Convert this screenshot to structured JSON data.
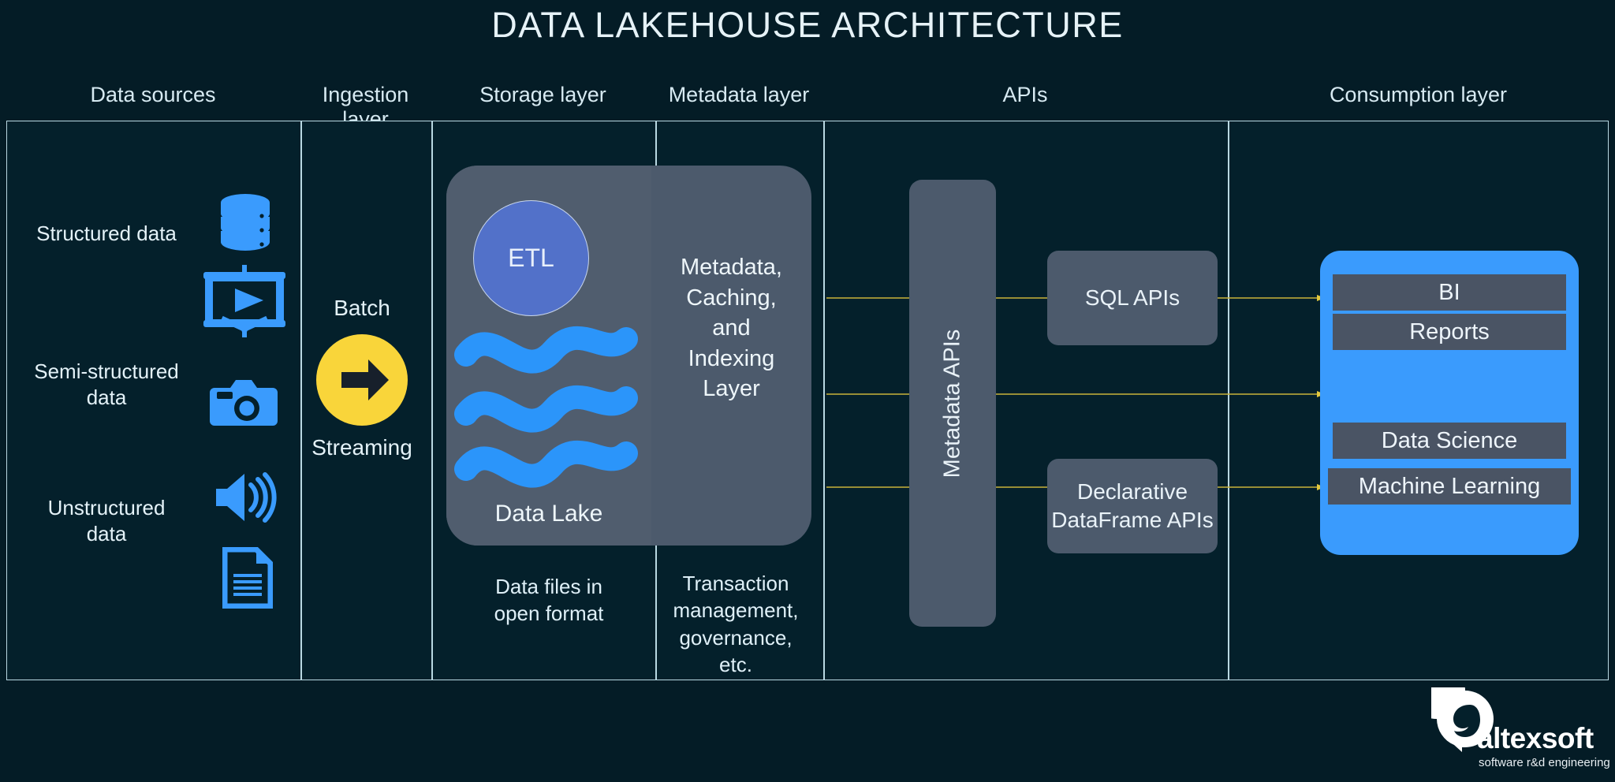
{
  "title": "DATA LAKEHOUSE ARCHITECTURE",
  "headers": {
    "data_sources": "Data sources",
    "ingestion": "Ingestion layer",
    "storage": "Storage layer",
    "metadata": "Metadata layer",
    "apis": "APIs",
    "consumption": "Consumption layer"
  },
  "sources": {
    "items": [
      {
        "label": "Structured data",
        "icons": [
          "database-icon"
        ]
      },
      {
        "label": "Semi-structured\ndata",
        "icons": [
          "video-screen-icon",
          "camera-icon"
        ]
      },
      {
        "label": "Unstructured\ndata",
        "icons": [
          "speaker-icon",
          "document-icon"
        ]
      }
    ]
  },
  "ingestion": {
    "top_label": "Batch",
    "bottom_label": "Streaming",
    "icon": "arrow-right-icon",
    "circle_color": "#f9d53a"
  },
  "storage": {
    "etl_label": "ETL",
    "lake_label": "Data Lake",
    "waves_icon": "water-waves-icon",
    "caption": "Data files in\nopen format",
    "etl_color": "#5271c9",
    "wave_color": "#2b95fa",
    "panel_color": "#4c5a6c"
  },
  "metadata": {
    "panel_text": "Metadata,\nCaching,\nand\nIndexing\nLayer",
    "caption": "Transaction\nmanagement,\ngovernance,\netc."
  },
  "apis": {
    "metadata_apis_label": "Metadata APIs",
    "boxes": [
      {
        "label": "SQL APIs"
      },
      {
        "label": "Declarative\nDataFrame APIs"
      }
    ],
    "connector_color": "#c9b23a"
  },
  "consumption": {
    "panel_color": "#3a9bfd",
    "items": [
      "BI",
      "Reports",
      "Data Science",
      "Machine Learning"
    ]
  },
  "logo": {
    "name": "altexsoft",
    "tagline": "software r&d engineering",
    "mark": "speech-bubble-a-icon"
  },
  "colors": {
    "background": "#041c26",
    "frame_border": "#b9d8e2",
    "frame_fill": "#04202b",
    "text": "#dff0f5",
    "icon_blue": "#3a9bfd",
    "panel_gray": "#4c5a6c",
    "bar_gray": "#4a5464"
  }
}
